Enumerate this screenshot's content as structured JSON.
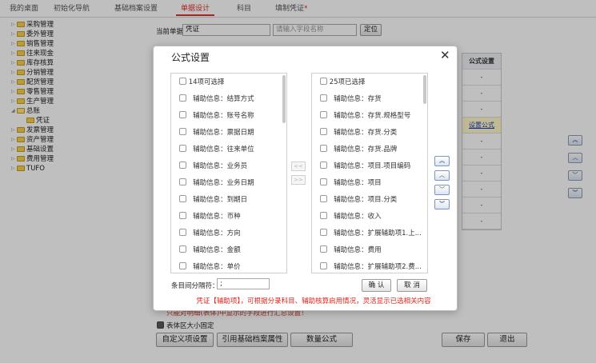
{
  "tabs": [
    {
      "label": "我的桌面",
      "active": false
    },
    {
      "label": "初始化导航",
      "active": false
    },
    {
      "label": "基础档案设置",
      "active": false
    },
    {
      "label": "单据设计",
      "active": true
    },
    {
      "label": "科目",
      "active": false
    },
    {
      "label": "填制凭证",
      "active": false,
      "modified_marker": "*"
    }
  ],
  "tree": [
    {
      "label": "采购管理"
    },
    {
      "label": "委外管理"
    },
    {
      "label": "销售管理"
    },
    {
      "label": "往来现金"
    },
    {
      "label": "库存核算"
    },
    {
      "label": "分销管理"
    },
    {
      "label": "配货管理"
    },
    {
      "label": "零售管理"
    },
    {
      "label": "生产管理"
    },
    {
      "label": "总账",
      "expanded": true
    },
    {
      "label": "凭证",
      "child": true
    },
    {
      "label": "发票管理"
    },
    {
      "label": "资产管理"
    },
    {
      "label": "基础设置"
    },
    {
      "label": "费用管理"
    },
    {
      "label": "TUFO"
    }
  ],
  "form": {
    "current_doc_label": "当前单据",
    "current_doc_value": "凭证",
    "field_search_placeholder": "请输入字段名称",
    "locate_button": "定位",
    "field_table_header": "公式设置",
    "field_table_cells": [
      "-",
      "-",
      "-",
      "设置公式",
      "-",
      "-",
      "-",
      "-",
      "-",
      "-",
      "-"
    ],
    "partial_note": "只能对明细(表体)中显示的字段进行汇总设置！",
    "fixed_size_label": "表体区大小固定",
    "fixed_size_checked": true
  },
  "bottom_buttons": {
    "custom": "自定义项设置",
    "reference": "引用基础档案属性",
    "quantity_formula": "数量公式",
    "save": "保存",
    "exit": "退出"
  },
  "dialog": {
    "title": "公式设置",
    "left_header": "14项可选择",
    "left_items": [
      "辅助信息：结算方式",
      "辅助信息：账号名称",
      "辅助信息：票据日期",
      "辅助信息：往来单位",
      "辅助信息：业务员",
      "辅助信息：业务日期",
      "辅助信息：到期日",
      "辅助信息：币种",
      "辅助信息：方向",
      "辅助信息：金额",
      "辅助信息：单价"
    ],
    "right_header": "25项已选择",
    "right_items": [
      "辅助信息：存货",
      "辅助信息：存货.规格型号",
      "辅助信息：存货.分类",
      "辅助信息：存货.品牌",
      "辅助信息：项目.项目编码",
      "辅助信息：项目",
      "辅助信息：项目.分类",
      "辅助信息：收入",
      "辅助信息：扩展辅助项1.上...",
      "辅助信息：费用",
      "辅助信息：扩展辅助项2.费..."
    ],
    "separator_label": "条目间分隔符：",
    "separator_value": ";",
    "ok_button": "确 认",
    "cancel_button": "取 消",
    "hint": "凭证【辅助项】，可根据分录科目、辅助核算启用情况，灵活显示已选相关内容"
  },
  "colors": {
    "accent": "#e0302a",
    "hint": "#e0241b",
    "link": "#1b3fbf",
    "folder": "#f6cf4e"
  }
}
